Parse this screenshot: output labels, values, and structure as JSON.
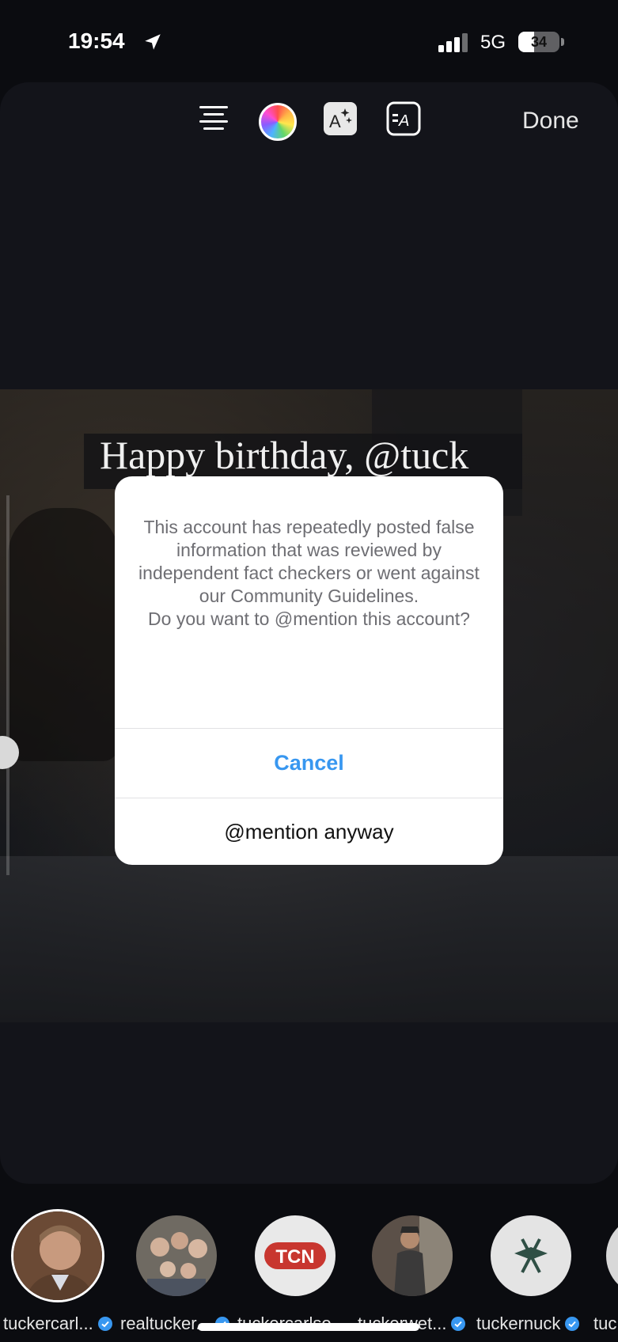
{
  "status_bar": {
    "time": "19:54",
    "network": "5G",
    "battery": "34"
  },
  "toolbar": {
    "done_label": "Done",
    "icons": [
      "text-align-icon",
      "color-wheel-icon",
      "text-effects-icon",
      "text-background-icon"
    ]
  },
  "story": {
    "text": "Happy birthday, @tuck"
  },
  "alert": {
    "message": "This account has repeatedly posted false information that was reviewed by independent fact checkers or went against our Community Guidelines.\nDo you want to @mention this account?",
    "cancel_label": "Cancel",
    "mention_label": "@mention anyway"
  },
  "suggestions": [
    {
      "label": "tuckercarl...",
      "verified": true
    },
    {
      "label": "realtucker...",
      "verified": true
    },
    {
      "label": "tuckercarlso...",
      "verified": false
    },
    {
      "label": "tuckerwet...",
      "verified": true
    },
    {
      "label": "tuckernuck",
      "verified": true
    },
    {
      "label": "tuc",
      "verified": false
    }
  ],
  "suggestion_logo_text": "TCN",
  "colors": {
    "accent_blue": "#3897f0",
    "verified_blue": "#3897f0",
    "background": "#0b0c10"
  }
}
